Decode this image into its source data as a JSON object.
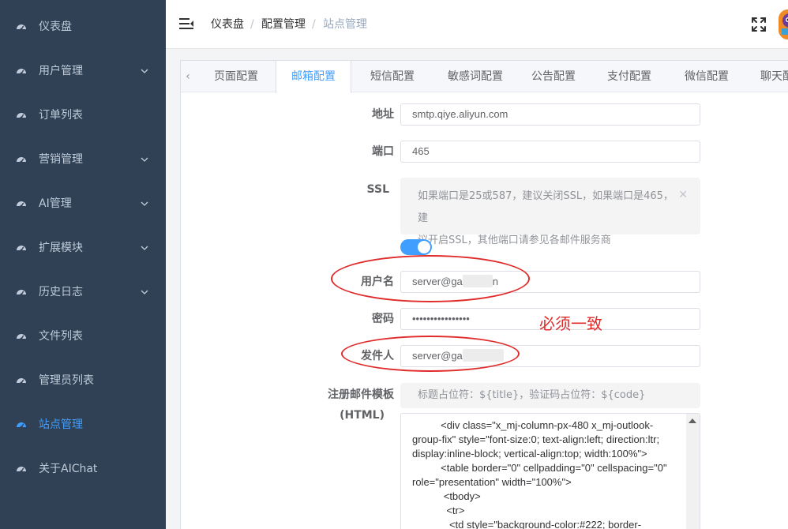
{
  "sidebar": {
    "items": [
      {
        "label": "仪表盘",
        "icon": "dashboard-icon",
        "has_arrow": false
      },
      {
        "label": "用户管理",
        "icon": "dashboard-icon",
        "has_arrow": true
      },
      {
        "label": "订单列表",
        "icon": "dashboard-icon",
        "has_arrow": false
      },
      {
        "label": "营销管理",
        "icon": "dashboard-icon",
        "has_arrow": true
      },
      {
        "label": "AI管理",
        "icon": "dashboard-icon",
        "has_arrow": true
      },
      {
        "label": "扩展模块",
        "icon": "dashboard-icon",
        "has_arrow": true
      },
      {
        "label": "历史日志",
        "icon": "dashboard-icon",
        "has_arrow": true
      },
      {
        "label": "文件列表",
        "icon": "dashboard-icon",
        "has_arrow": false
      },
      {
        "label": "管理员列表",
        "icon": "dashboard-icon",
        "has_arrow": false
      },
      {
        "label": "站点管理",
        "icon": "dashboard-icon",
        "has_arrow": false,
        "active": true
      },
      {
        "label": "关于AIChat",
        "icon": "dashboard-icon",
        "has_arrow": false
      }
    ]
  },
  "breadcrumb": {
    "items": [
      "仪表盘",
      "配置管理",
      "站点管理"
    ],
    "separator": "/"
  },
  "tabs": {
    "items": [
      "页面配置",
      "邮箱配置",
      "短信配置",
      "敏感词配置",
      "公告配置",
      "支付配置",
      "微信配置",
      "聊天配"
    ],
    "active_index": 1
  },
  "form": {
    "address_label": "地址",
    "address_value": "smtp.qiye.aliyun.com",
    "port_label": "端口",
    "port_value": "465",
    "ssl_label": "SSL",
    "ssl_tip_line1": "如果端口是25或587，建议关闭SSL，如果端口是465，建",
    "ssl_tip_line2": "议开启SSL，其他端口请参见各邮件服务商",
    "ssl_enabled": true,
    "username_label": "用户名",
    "username_value_visible_start": "server@ga",
    "username_value_visible_end": "n",
    "password_label": "密码",
    "password_value": "••••••••••••••••",
    "sender_label": "发件人",
    "sender_value_visible": "server@ga",
    "template_label_line1": "注册邮件模板",
    "template_label_line2": "(HTML)",
    "template_placeholder_tip": "标题占位符：${title}，验证码占位符：${code}",
    "template_code": [
      "          <div class=\"x_mj-column-px-480 x_mj-outlook-",
      "group-fix\" style=\"font-size:0; text-align:left; direction:ltr;",
      "display:inline-block; vertical-align:top; width:100%\">",
      "          <table border=\"0\" cellpadding=\"0\" cellspacing=\"0\"",
      "role=\"presentation\" width=\"100%\">",
      "           <tbody>",
      "            <tr>",
      "             <td style=\"background-color:#222; border-"
    ]
  },
  "annotation": {
    "note": "必须一致",
    "color": "#e02b2b"
  },
  "colors": {
    "sidebar_bg": "#304156",
    "sidebar_text": "#bfcbd9",
    "accent": "#409eff"
  }
}
